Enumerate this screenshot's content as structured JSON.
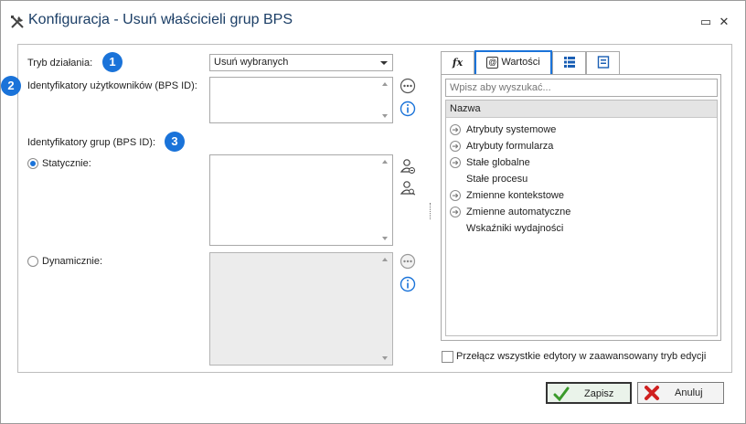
{
  "window": {
    "title": "Konfiguracja - Usuń właścicieli grup BPS",
    "icon": "tools-icon",
    "controls": {
      "restore": "▭",
      "close": "✕"
    }
  },
  "form": {
    "mode_label": "Tryb działania:",
    "mode_badge": "1",
    "mode_value": "Usuń wybranych",
    "user_ids_label": "Identyfikatory użytkowników (BPS ID):",
    "user_ids_badge": "2",
    "user_ids_value": "",
    "group_ids_label": "Identyfikatory grup (BPS ID):",
    "group_ids_badge": "3",
    "static_label": "Statycznie:",
    "static_value": "",
    "dynamic_label": "Dynamicznie:",
    "dynamic_value": ""
  },
  "right_panel": {
    "tabs": [
      {
        "label": "fx",
        "icon": "function-icon"
      },
      {
        "label": "Wartości",
        "icon": "values-icon"
      },
      {
        "label": "",
        "icon": "list-icon"
      },
      {
        "label": "",
        "icon": "form-icon"
      }
    ],
    "search_placeholder": "Wpisz aby wyszukać...",
    "list_header": "Nazwa",
    "items": [
      {
        "label": "Atrybuty systemowe",
        "expandable": true
      },
      {
        "label": "Atrybuty formularza",
        "expandable": true
      },
      {
        "label": "Stałe globalne",
        "expandable": true
      },
      {
        "label": "Stałe procesu",
        "expandable": false
      },
      {
        "label": "Zmienne kontekstowe",
        "expandable": true
      },
      {
        "label": "Zmienne automatyczne",
        "expandable": true
      },
      {
        "label": "Wskaźniki wydajności",
        "expandable": false
      }
    ],
    "toggle_label": "Przełącz wszystkie edytory w zaawansowany tryb edycji"
  },
  "footer": {
    "save_label": "Zapisz",
    "cancel_label": "Anuluj"
  },
  "colors": {
    "accent": "#1a73d9",
    "title": "#1b3e66"
  }
}
